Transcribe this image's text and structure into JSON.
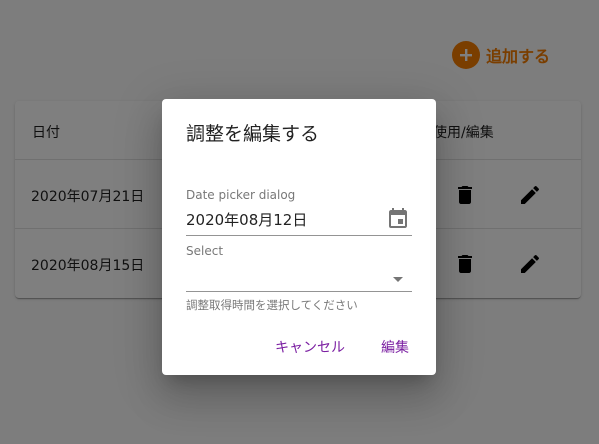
{
  "toolbar": {
    "add_label": "追加する",
    "add_icon": "plus-circle-icon"
  },
  "table": {
    "columns": {
      "date": "日付",
      "action": "使用/編集"
    },
    "rows": [
      {
        "date": "2020年07月21日"
      },
      {
        "date": "2020年08月15日"
      }
    ]
  },
  "dialog": {
    "title": "調整を編集する",
    "date_label": "Date picker dialog",
    "date_value": "2020年08月12日",
    "select_label": "Select",
    "select_value": "",
    "helper": "調整取得時間を選択してください",
    "cancel_label": "キャンセル",
    "edit_label": "編集"
  },
  "colors": {
    "accent": "#f57c00",
    "primary": "#7b1fa2",
    "backdrop": "rgba(0,0,0,0.5)"
  }
}
